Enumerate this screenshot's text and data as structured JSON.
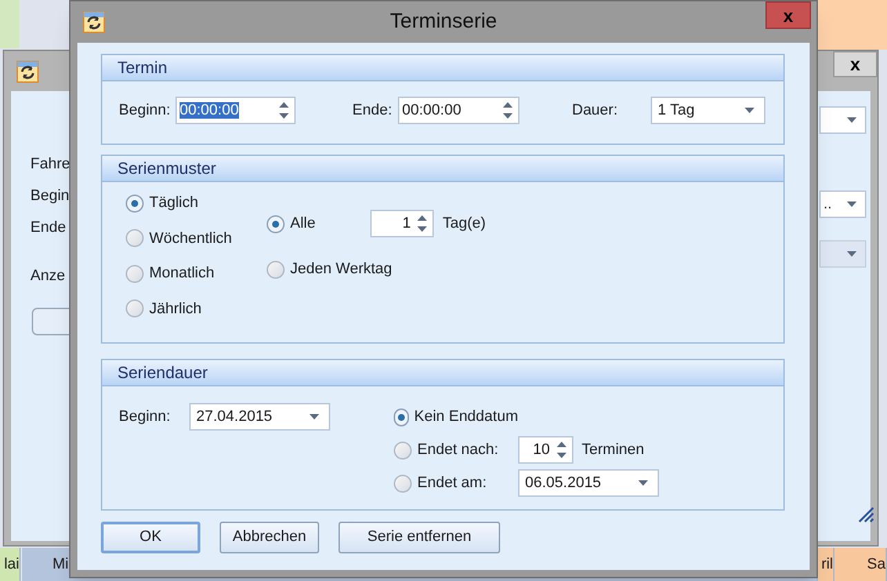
{
  "background_window": {
    "close": "x",
    "labels": [
      "Fahre",
      "Begin",
      "Ende",
      "Anze"
    ],
    "dropdowns": [
      {
        "disabled": false
      },
      {
        "value": "..",
        "disabled": false
      },
      {
        "disabled": true
      }
    ]
  },
  "calendar_header": [
    {
      "text": "lai",
      "color": "#cfe6b0"
    },
    {
      "text": "Mi",
      "color": "#b4c4dc"
    },
    {
      "text": "ril",
      "color": "#f8c89c"
    },
    {
      "text": "Sa",
      "color": "#f8c89c"
    }
  ],
  "dialog": {
    "title": "Terminserie",
    "close": "x",
    "termin": {
      "title": "Termin",
      "beginn_label": "Beginn:",
      "beginn_value": "00:00:00",
      "beginn_text_selected": true,
      "ende_label": "Ende:",
      "ende_value": "00:00:00",
      "dauer_label": "Dauer:",
      "dauer_value": "1 Tag"
    },
    "serienmuster": {
      "title": "Serienmuster",
      "patterns": [
        {
          "label": "Täglich",
          "selected": true
        },
        {
          "label": "Wöchentlich",
          "selected": false
        },
        {
          "label": "Monatlich",
          "selected": false
        },
        {
          "label": "Jährlich",
          "selected": false
        }
      ],
      "options": [
        {
          "kind": "interval",
          "label": "Alle",
          "selected": true,
          "value": "1",
          "unit": "Tag(e)"
        },
        {
          "kind": "plain",
          "label": "Jeden Werktag",
          "selected": false
        }
      ]
    },
    "seriendauer": {
      "title": "Seriendauer",
      "beginn_label": "Beginn:",
      "beginn_value": "27.04.2015",
      "end_options": [
        {
          "kind": "plain",
          "label": "Kein Enddatum",
          "selected": true
        },
        {
          "kind": "count",
          "label": "Endet nach:",
          "value": "10",
          "unit": "Terminen",
          "selected": false
        },
        {
          "kind": "date",
          "label": "Endet am:",
          "value": "06.05.2015",
          "selected": false
        }
      ]
    },
    "buttons": [
      {
        "label": "OK",
        "default": true
      },
      {
        "label": "Abbrechen",
        "default": false
      },
      {
        "label": "Serie entfernen",
        "default": false
      }
    ]
  }
}
